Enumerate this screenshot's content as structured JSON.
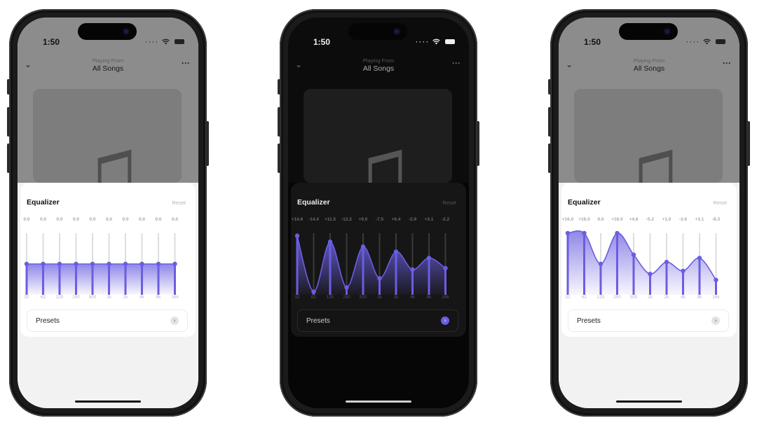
{
  "phones": [
    {
      "theme": "light",
      "status": {
        "time": "1:50"
      },
      "header": {
        "playing_from": "Playing From",
        "title": "All Songs"
      },
      "equalizer": {
        "title": "Equalizer",
        "reset_label": "Reset",
        "gain_labels": [
          "0.0",
          "0.0",
          "0.0",
          "0.0",
          "0.0",
          "0.0",
          "0.0",
          "0.0",
          "0.0",
          "0.0"
        ],
        "gains_db": [
          0,
          0,
          0,
          0,
          0,
          0,
          0,
          0,
          0,
          0
        ],
        "frequencies": [
          "32",
          "62",
          "125",
          "250",
          "500",
          "1k",
          "2k",
          "4k",
          "8k",
          "16k"
        ]
      },
      "presets": {
        "label": "Presets"
      }
    },
    {
      "theme": "dark",
      "status": {
        "time": "1:50"
      },
      "header": {
        "playing_from": "Playing From",
        "title": "All Songs"
      },
      "equalizer": {
        "title": "Equalizer",
        "reset_label": "Reset",
        "gain_labels": [
          "+14.6",
          "-14.4",
          "+11.5",
          "-12.2",
          "+9.0",
          "-7.5",
          "+6.4",
          "-2.9",
          "+3.1",
          "-2.2"
        ],
        "gains_db": [
          14.6,
          -14.4,
          11.5,
          -12.2,
          9.0,
          -7.5,
          6.4,
          -2.9,
          3.1,
          -2.2
        ],
        "frequencies": [
          "32",
          "62",
          "125",
          "250",
          "500",
          "1k",
          "2k",
          "4k",
          "8k",
          "16k"
        ]
      },
      "presets": {
        "label": "Presets"
      }
    },
    {
      "theme": "light",
      "status": {
        "time": "1:50"
      },
      "header": {
        "playing_from": "Playing From",
        "title": "All Songs"
      },
      "equalizer": {
        "title": "Equalizer",
        "reset_label": "Reset",
        "gain_labels": [
          "+16.0",
          "+16.0",
          "0.0",
          "+16.0",
          "+4.8",
          "-5.2",
          "+1.0",
          "-3.6",
          "+3.1",
          "-8.3"
        ],
        "gains_db": [
          16.0,
          16.0,
          0,
          16.0,
          4.8,
          -5.2,
          1.0,
          -3.6,
          3.1,
          -8.3
        ],
        "frequencies": [
          "32",
          "62",
          "125",
          "250",
          "500",
          "1k",
          "2k",
          "4k",
          "8k",
          "16k"
        ]
      },
      "presets": {
        "label": "Presets"
      }
    }
  ],
  "colors": {
    "accent": "#6a5ee0"
  },
  "icons": [
    "chevron-down-icon",
    "more-icon",
    "music-note-icon",
    "wifi-icon",
    "battery-icon",
    "chevron-right-icon"
  ]
}
